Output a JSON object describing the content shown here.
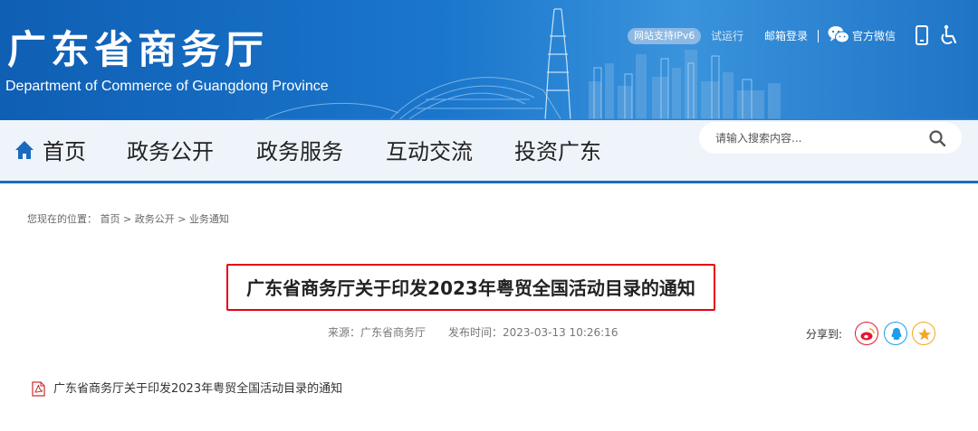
{
  "header": {
    "site_title": "广东省商务厅",
    "site_subtitle": "Department of Commerce of Guangdong Province",
    "ipv6_badge": "网站支持IPv6",
    "ipv6_note": "试运行",
    "mail_login": "邮箱登录",
    "divider": "|",
    "wechat": "官方微信"
  },
  "nav": {
    "items": [
      {
        "label": "首页"
      },
      {
        "label": "政务公开"
      },
      {
        "label": "政务服务"
      },
      {
        "label": "互动交流"
      },
      {
        "label": "投资广东"
      }
    ],
    "search_placeholder": "请输入搜索内容..."
  },
  "breadcrumb": {
    "prefix": "您现在的位置：",
    "items": [
      "首页",
      "政务公开",
      "业务通知"
    ],
    "separator": ">"
  },
  "article": {
    "title": "广东省商务厅关于印发2023年粤贸全国活动目录的通知",
    "source": "来源：广东省商务厅",
    "publish_time": "发布时间：2023-03-13 10:26:16",
    "share_label": "分享到:",
    "attachment": "广东省商务厅关于印发2023年粤贸全国活动目录的通知"
  },
  "colors": {
    "banner_blue": "#1a76cc",
    "nav_accent": "#1a6bbd",
    "highlight_red": "#e60012",
    "weibo": "#e6162d",
    "qq": "#1e9ce8",
    "favorite": "#f5a623"
  },
  "icons": [
    "home-icon",
    "wechat-icon",
    "phone-icon",
    "accessibility-icon",
    "search-icon",
    "weibo-icon",
    "qq-icon",
    "star-icon",
    "pdf-icon"
  ]
}
